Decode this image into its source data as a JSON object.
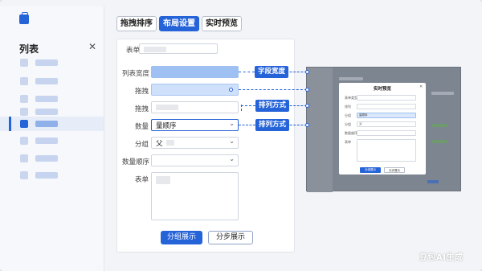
{
  "sidebar": {
    "title": "列表",
    "items": [
      {
        "active": false
      },
      {
        "active": false
      },
      {
        "active": false
      },
      {
        "active": false
      },
      {
        "active": true
      },
      {
        "active": false
      },
      {
        "active": false
      },
      {
        "active": false
      }
    ]
  },
  "toolbar": {
    "drag_sort": "拖拽排序",
    "layout_settings": "布局设置",
    "live_preview": "实时预览"
  },
  "form": {
    "fields": [
      {
        "label": "表单"
      },
      {
        "label": "列表宽度"
      },
      {
        "label": "拖拽"
      },
      {
        "label": "拖拽"
      },
      {
        "label": "数量",
        "value": "量顺序"
      },
      {
        "label": "分组",
        "value": "父"
      },
      {
        "label": "数量顺序"
      },
      {
        "label": "表单"
      }
    ],
    "group_show": "分组展示",
    "step_show": "分步展示"
  },
  "callouts": {
    "field_width": "字段宽度",
    "arrange_1": "排列方式",
    "arrange_2": "排列方式"
  },
  "preview": {
    "modal_title": "实时预览",
    "field_labels": [
      "表单类型",
      "排列",
      "分组",
      "分组",
      "数量顺序",
      "表单"
    ],
    "field_values": [
      "",
      "",
      "量顺序",
      "父",
      "",
      ""
    ],
    "confirm": "分组展示",
    "cancel": "分步展示"
  },
  "watermark": "豆包AI生成",
  "colors": {
    "accent": "#2563d9",
    "accent_light": "#9ec0f2"
  }
}
